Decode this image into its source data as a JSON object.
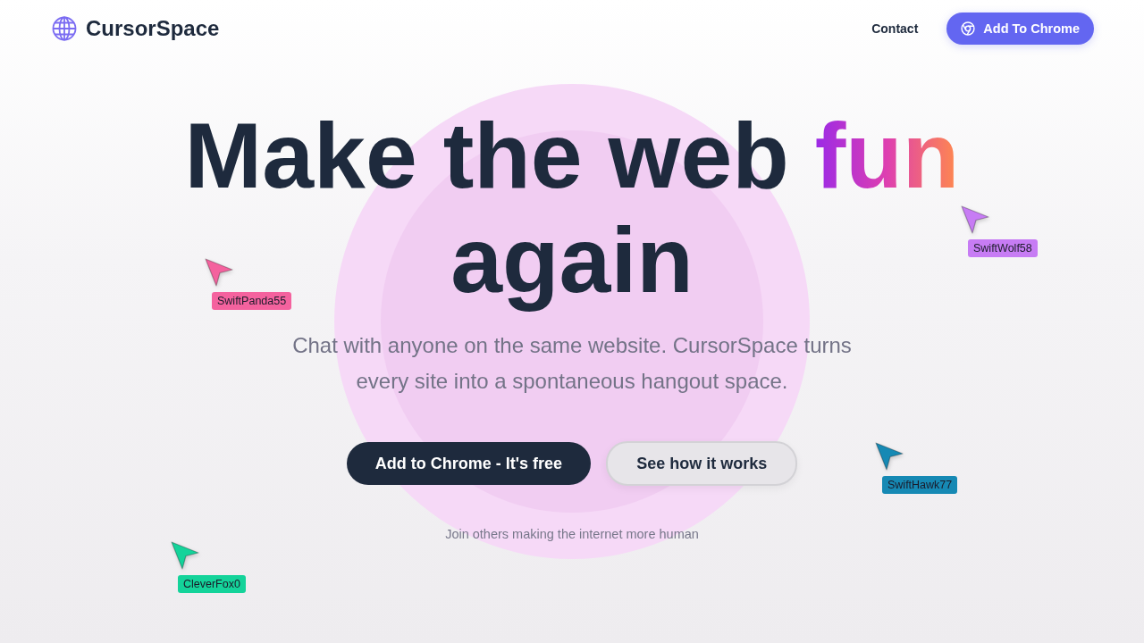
{
  "nav": {
    "logo": "CursorSpace",
    "links": [
      {
        "label": "Contact"
      }
    ],
    "cta": "Add To Chrome"
  },
  "hero": {
    "headline": {
      "lead": "Make the web",
      "highlight": "fun",
      "tail": "again"
    },
    "subtitle": "Chat with anyone on the same website. CursorSpace turns every site into a spontaneous hangout space.",
    "buttons": [
      {
        "label": "Add to Chrome - It's free",
        "kind": "primary"
      },
      {
        "label": "See how it works",
        "kind": "secondary"
      }
    ],
    "note": "Join others making the internet more human"
  },
  "cursors": [
    {
      "name": "SwiftPanda55",
      "color": "#f4629e"
    },
    {
      "name": "SwiftWolf58",
      "color": "#c77cf4"
    },
    {
      "name": "SwiftHawk77",
      "color": "#1689b4"
    },
    {
      "name": "CleverFox0",
      "color": "#14d39a"
    }
  ]
}
